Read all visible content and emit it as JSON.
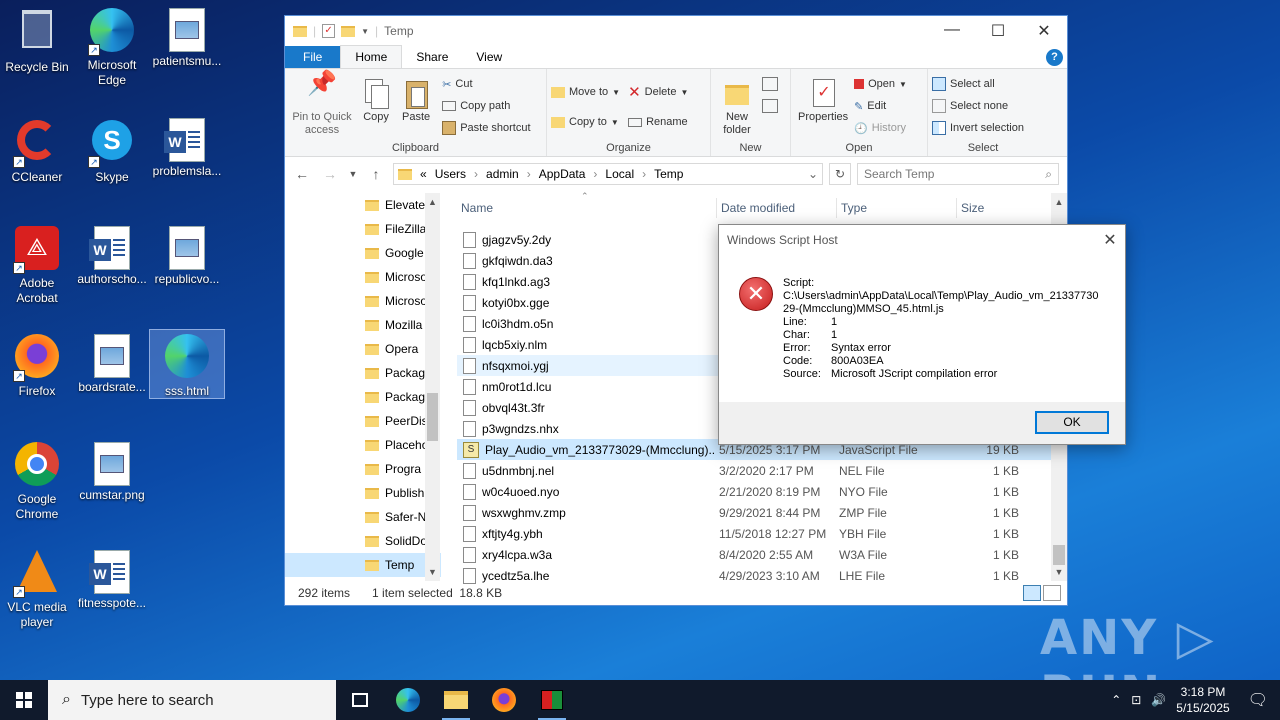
{
  "desktop": {
    "icons": [
      {
        "label": "Recycle Bin"
      },
      {
        "label": "Microsoft Edge"
      },
      {
        "label": "patientsmu..."
      },
      {
        "label": "CCleaner"
      },
      {
        "label": "Skype"
      },
      {
        "label": "problemsla..."
      },
      {
        "label": "Adobe Acrobat"
      },
      {
        "label": "authorscho..."
      },
      {
        "label": "republicvo..."
      },
      {
        "label": "Firefox"
      },
      {
        "label": "boardsrate..."
      },
      {
        "label": "sss.html"
      },
      {
        "label": "Google Chrome"
      },
      {
        "label": "cumstar.png"
      },
      {
        "label": "VLC media player"
      },
      {
        "label": "fitnesspote..."
      }
    ]
  },
  "explorer": {
    "title": "Temp",
    "tabs": {
      "file": "File",
      "home": "Home",
      "share": "Share",
      "view": "View"
    },
    "help": "?",
    "ribbon": {
      "clipboard": {
        "pin": "Pin to Quick access",
        "copy": "Copy",
        "paste": "Paste",
        "cut": "Cut",
        "copy_path": "Copy path",
        "paste_shortcut": "Paste shortcut",
        "label": "Clipboard"
      },
      "organize": {
        "move_to": "Move to",
        "copy_to": "Copy to",
        "delete": "Delete",
        "rename": "Rename",
        "label": "Organize"
      },
      "new": {
        "new_folder": "New folder",
        "label": "New"
      },
      "open": {
        "properties": "Properties",
        "open": "Open",
        "edit": "Edit",
        "history": "History",
        "label": "Open"
      },
      "select": {
        "select_all": "Select all",
        "select_none": "Select none",
        "invert": "Invert selection",
        "label": "Select"
      }
    },
    "address": {
      "prefix": "«",
      "crumbs": [
        "Users",
        "admin",
        "AppData",
        "Local",
        "Temp"
      ],
      "search_placeholder": "Search Temp"
    },
    "nav_items": [
      "Elevate",
      "FileZilla",
      "Google",
      "Microso",
      "Microso",
      "Mozilla",
      "Opera",
      "Packag",
      "Packag",
      "PeerDis",
      "Placeho",
      "Progra",
      "Publish",
      "Safer-N",
      "SolidDo",
      "Temp"
    ],
    "columns": {
      "name": "Name",
      "modified": "Date modified",
      "type": "Type",
      "size": "Size"
    },
    "files": [
      {
        "name": "gjagzv5y.2dy",
        "modified": "",
        "type": "",
        "size": ""
      },
      {
        "name": "gkfqiwdn.da3",
        "modified": "",
        "type": "",
        "size": ""
      },
      {
        "name": "kfq1lnkd.ag3",
        "modified": "",
        "type": "",
        "size": ""
      },
      {
        "name": "kotyi0bx.gge",
        "modified": "",
        "type": "",
        "size": ""
      },
      {
        "name": "lc0i3hdm.o5n",
        "modified": "",
        "type": "",
        "size": ""
      },
      {
        "name": "lqcb5xiy.nlm",
        "modified": "",
        "type": "",
        "size": ""
      },
      {
        "name": "nfsqxmoi.ygj",
        "modified": "",
        "type": "",
        "size": ""
      },
      {
        "name": "nm0rot1d.lcu",
        "modified": "",
        "type": "",
        "size": ""
      },
      {
        "name": "obvql43t.3fr",
        "modified": "",
        "type": "",
        "size": ""
      },
      {
        "name": "p3wgndzs.nhx",
        "modified": "",
        "type": "",
        "size": ""
      },
      {
        "name": "Play_Audio_vm_2133773029-(Mmcclung)...",
        "modified": "5/15/2025 3:17 PM",
        "type": "JavaScript File",
        "size": "19 KB"
      },
      {
        "name": "u5dnmbnj.nel",
        "modified": "3/2/2020 2:17 PM",
        "type": "NEL File",
        "size": "1 KB"
      },
      {
        "name": "w0c4uoed.nyo",
        "modified": "2/21/2020 8:19 PM",
        "type": "NYO File",
        "size": "1 KB"
      },
      {
        "name": "wsxwghmv.zmp",
        "modified": "9/29/2021 8:44 PM",
        "type": "ZMP File",
        "size": "1 KB"
      },
      {
        "name": "xftjty4g.ybh",
        "modified": "11/5/2018 12:27 PM",
        "type": "YBH File",
        "size": "1 KB"
      },
      {
        "name": "xry4lcpa.w3a",
        "modified": "8/4/2020 2:55 AM",
        "type": "W3A File",
        "size": "1 KB"
      },
      {
        "name": "ycedtz5a.lhe",
        "modified": "4/29/2023 3:10 AM",
        "type": "LHE File",
        "size": "1 KB"
      }
    ],
    "status": {
      "count": "292 items",
      "selection": "1 item selected  18.8 KB"
    }
  },
  "dialog": {
    "title": "Windows Script Host",
    "script_label": "Script:",
    "script_path": "C:\\Users\\admin\\AppData\\Local\\Temp\\Play_Audio_vm_2133773029-(Mmcclung)MMSO_45.html.js",
    "fields": [
      {
        "k": "Line:",
        "v": "1"
      },
      {
        "k": "Char:",
        "v": "1"
      },
      {
        "k": "Error:",
        "v": "Syntax error"
      },
      {
        "k": "Code:",
        "v": "800A03EA"
      },
      {
        "k": "Source:",
        "v": "Microsoft JScript compilation error"
      }
    ],
    "ok": "OK"
  },
  "watermark": "ANY ▷ RUN",
  "taskbar": {
    "search_placeholder": "Type here to search",
    "time": "3:18 PM",
    "date": "5/15/2025"
  }
}
